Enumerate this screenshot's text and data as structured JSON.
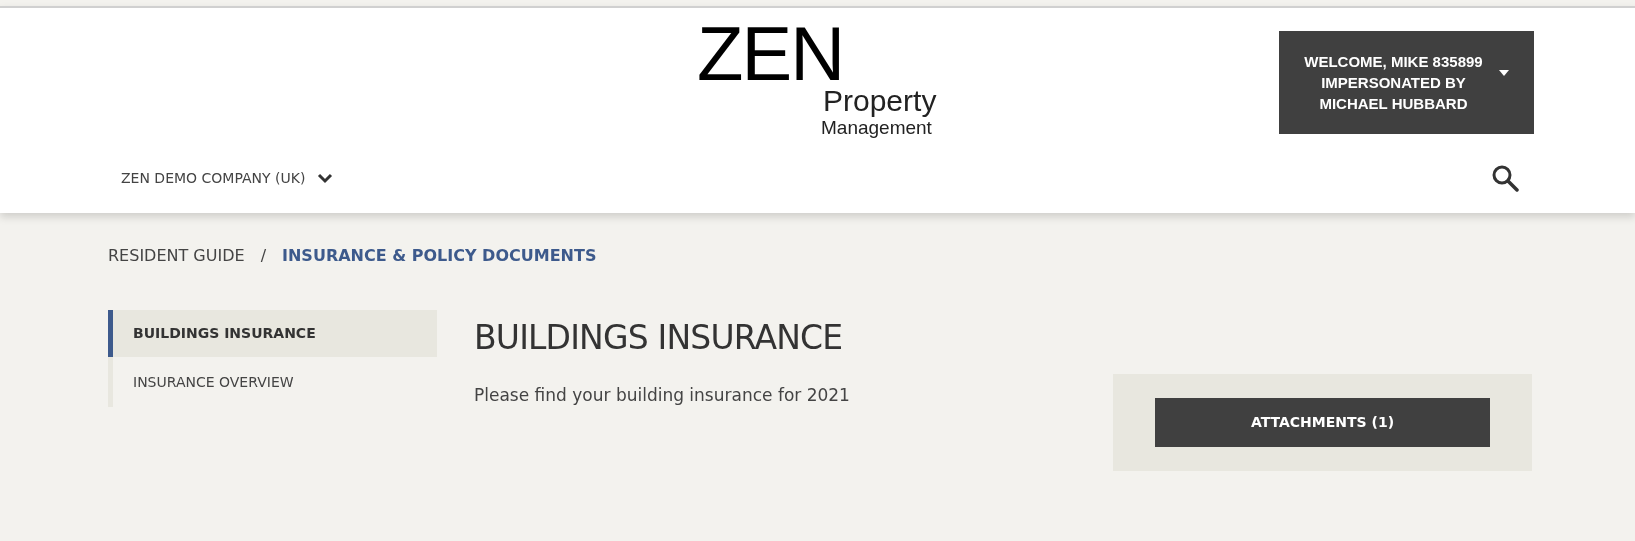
{
  "logo": {
    "main": "ZEN",
    "line_1": "Property",
    "line_2": "Management"
  },
  "user_menu": {
    "lines": [
      "WELCOME, MIKE 835899",
      "IMPERSONATED BY",
      "MICHAEL HUBBARD"
    ]
  },
  "company_selector": {
    "label": "ZEN DEMO COMPANY (UK)"
  },
  "breadcrumb_separator": "/",
  "breadcrumb": [
    {
      "label": "RESIDENT GUIDE",
      "current": false
    },
    {
      "label": "INSURANCE & POLICY DOCUMENTS",
      "current": true
    }
  ],
  "sidebar": {
    "items": [
      {
        "label": "BUILDINGS INSURANCE",
        "selected": true
      },
      {
        "label": "INSURANCE OVERVIEW",
        "selected": false
      }
    ]
  },
  "article": {
    "title": "BUILDINGS INSURANCE",
    "body": "Please find your building insurance for 2021"
  },
  "attachments_button": {
    "label": "ATTACHMENTS (1)"
  }
}
